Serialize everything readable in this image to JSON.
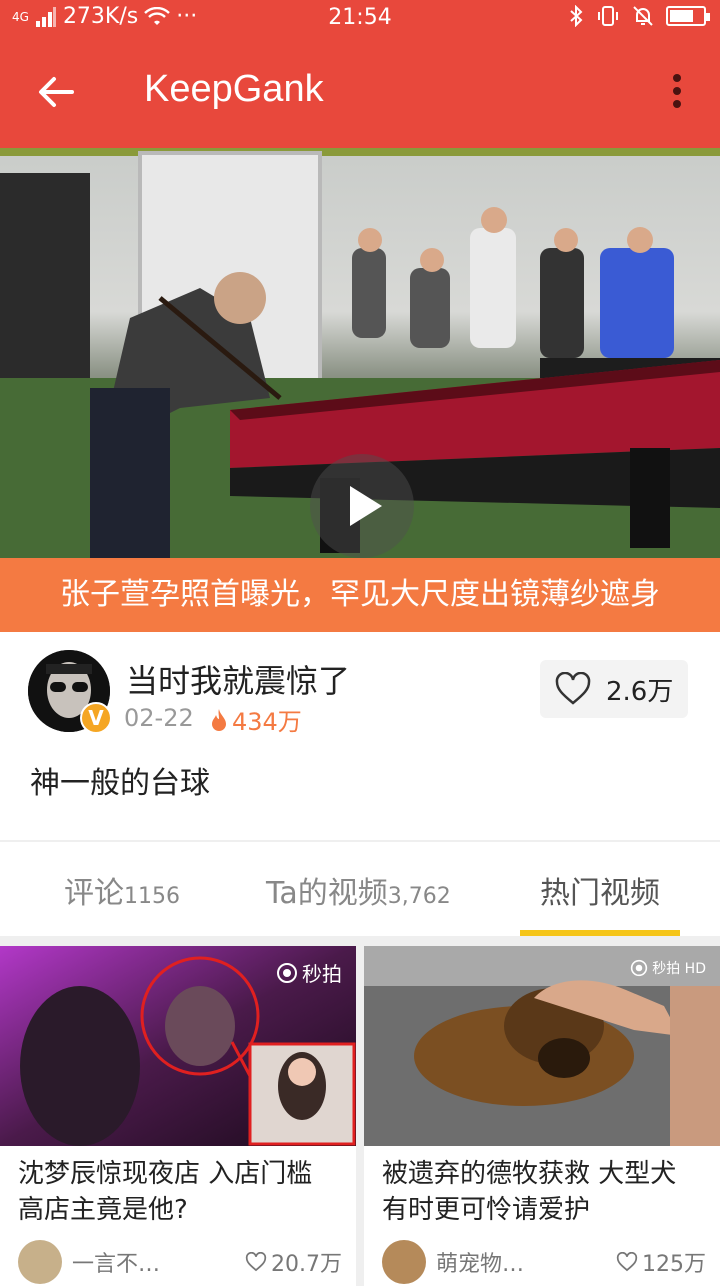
{
  "status_bar": {
    "network": "4G",
    "speed": "273K/s",
    "dots": "···",
    "time": "21:54",
    "battery_level": 0.65
  },
  "app_bar": {
    "title": "KeepGank"
  },
  "video": {
    "banner_text": "张子萱孕照首曝光，罕见大尺度出镜薄纱遮身"
  },
  "post": {
    "author": "当时我就震惊了",
    "verified_badge": "V",
    "date": "02-22",
    "views": "434万",
    "likes": "2.6万",
    "description": "神一般的台球"
  },
  "tabs": [
    {
      "label": "评论",
      "count": "1156"
    },
    {
      "label": "Ta的视频",
      "count": "3,762"
    },
    {
      "label": "热门视频",
      "count": ""
    }
  ],
  "cards": [
    {
      "title": "沈梦辰惊现夜店 入店门槛高店主竟是他?",
      "watermark": "秒拍",
      "author": "一言不…",
      "likes": "20.7万"
    },
    {
      "title": "被遗弃的德牧获救 大型犬有时更可怜请爱护",
      "watermark": "秒拍 HD",
      "author": "萌宠物…",
      "likes": "125万"
    }
  ],
  "colors": {
    "primary": "#e8483c",
    "banner": "#f47a42",
    "tab_indicator": "#f5c518"
  }
}
